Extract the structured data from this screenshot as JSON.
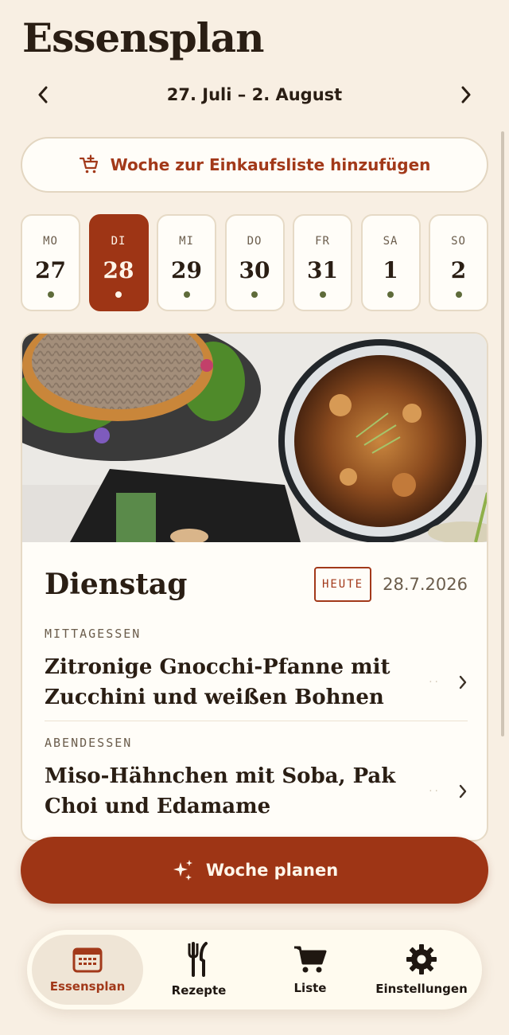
{
  "header": {
    "title": "Essensplan"
  },
  "week": {
    "range": "27. Juli – 2. August"
  },
  "shopping": {
    "label": "Woche zur Einkaufsliste hinzufügen"
  },
  "days": [
    {
      "name": "MO",
      "num": "27"
    },
    {
      "name": "DI",
      "num": "28",
      "active": true
    },
    {
      "name": "MI",
      "num": "29"
    },
    {
      "name": "DO",
      "num": "30"
    },
    {
      "name": "FR",
      "num": "31"
    },
    {
      "name": "SA",
      "num": "1"
    },
    {
      "name": "SO",
      "num": "2"
    }
  ],
  "card": {
    "day": "Dienstag",
    "badge": "HEUTE",
    "date": "28.7.2026",
    "lunch": {
      "label": "MITTAGESSEN",
      "title": "Zitronige Gnocchi-Pfanne mit Zucchini und weißen Bohnen"
    },
    "dinner": {
      "label": "ABENDESSEN",
      "title": "Miso-Hähnchen mit Soba, Pak Choi und Edamame"
    }
  },
  "plan": {
    "label": "Woche planen"
  },
  "tabs": [
    {
      "label": "Essensplan",
      "icon": "calendar-icon",
      "active": true
    },
    {
      "label": "Rezepte",
      "icon": "fork-knife-icon"
    },
    {
      "label": "Liste",
      "icon": "cart-icon"
    },
    {
      "label": "Einstellungen",
      "icon": "gear-icon"
    }
  ],
  "colors": {
    "accent": "#9e3515",
    "background": "#f8efe3",
    "dot": "#5e6b3a"
  }
}
